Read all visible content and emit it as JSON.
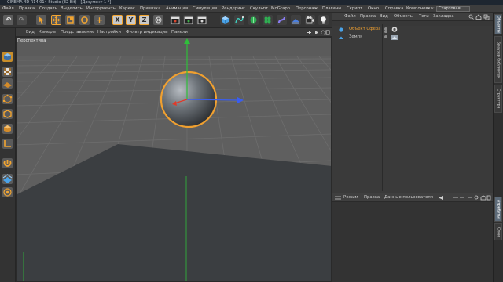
{
  "window": {
    "title": "CINEMA 4D R14.014 Studio (32 Bit) - [Документ 1 *]"
  },
  "main_menu": {
    "items": [
      "Файл",
      "Правка",
      "Создать",
      "Выделить",
      "Инструменты",
      "Каркас",
      "Привязка",
      "Анимация",
      "Симуляция",
      "Рендеринг",
      "Скульпт",
      "MoGraph",
      "Персонаж",
      "Плагины",
      "Скрипт",
      "Окно",
      "Справка",
      "Компоновка:"
    ],
    "layout_value": "Стартовая"
  },
  "toolbar": {
    "icons": [
      "undo-icon",
      "redo-icon",
      "live-select-icon",
      "move-icon",
      "scale-icon",
      "rotate-icon",
      "plus-icon",
      "x-axis-icon",
      "y-axis-icon",
      "z-axis-icon",
      "coordinate-system-icon",
      "render-view-icon",
      "render-picture-icon",
      "render-settings-icon",
      "cube-icon",
      "spline-pen-icon",
      "subdivision-icon",
      "cloner-icon",
      "deformer-icon",
      "environment-icon",
      "camera-icon",
      "light-icon"
    ],
    "axis_labels": [
      "X",
      "Y",
      "Z"
    ]
  },
  "viewport": {
    "menu": [
      "Вид",
      "Камеры",
      "Представление",
      "Настройки",
      "Фильтр индикации",
      "Панели"
    ],
    "label": "Перспектива"
  },
  "objects_panel": {
    "menu": [
      "Файл",
      "Правка",
      "Вид",
      "Объекты",
      "Теги",
      "Закладка"
    ],
    "rows": [
      {
        "name": "Объект Сфера",
        "color": "#f0a030"
      },
      {
        "name": "Земля",
        "color": "#c8c8c8"
      }
    ]
  },
  "attributes_panel": {
    "menu": [
      "Режим",
      "Правка",
      "Данные пользователя"
    ]
  },
  "right_tabs": {
    "top": [
      "Объекты",
      "Браузер библиотек",
      "Структура"
    ],
    "bottom": [
      "Атрибуты",
      "Слои"
    ]
  },
  "colors": {
    "accent_orange": "#f0a030",
    "axis_x": "#e03a2a",
    "axis_y": "#2fbf3a",
    "axis_z": "#3a5ef0",
    "floor": "#3b3e41",
    "grid_plane": "#5f5f5f"
  }
}
